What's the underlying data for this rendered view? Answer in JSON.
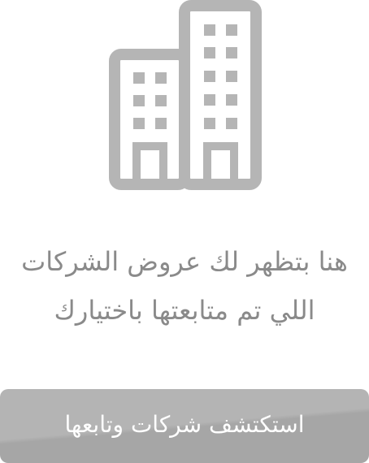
{
  "empty_state": {
    "icon": "building-icon",
    "message_line1": "هنا بتظهر لك عروض الشركات",
    "message_line2": "اللي تم متابعتها باختيارك",
    "button_label": "استكتشف شركات وتابعها"
  },
  "colors": {
    "icon_gray": "#b5b5b5",
    "text_gray": "#8a8a8a",
    "button_gray": "#b0b0b0",
    "button_text": "#ffffff"
  }
}
